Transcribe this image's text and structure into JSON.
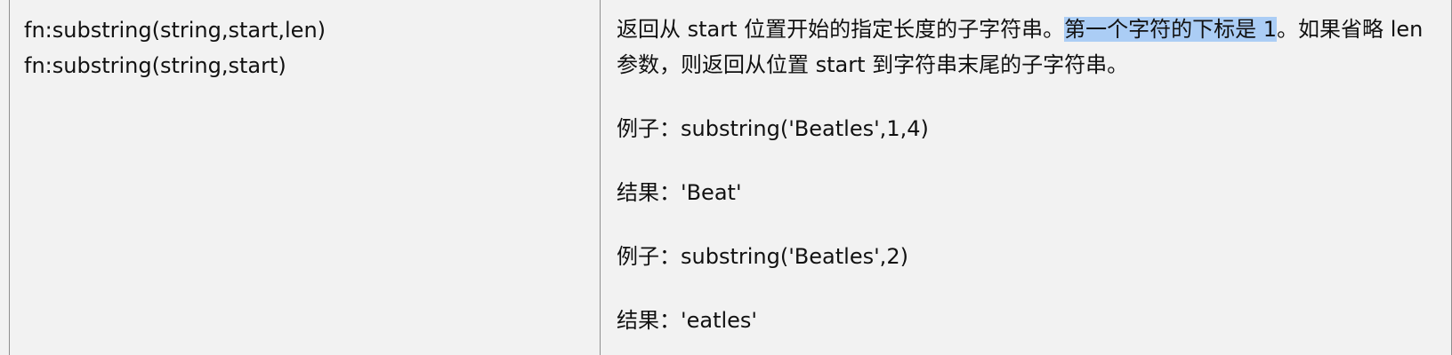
{
  "signature_cell": {
    "lines": [
      "fn:substring(string,start,len)",
      "fn:substring(string,start)"
    ]
  },
  "description_cell": {
    "text_before_highlight": "返回从 start 位置开始的指定长度的子字符串。",
    "highlighted_text": "第一个字符的下标是 1",
    "text_after_highlight": "。如果省略 len 参数，则返回从位置 start 到字符串末尾的子字符串。",
    "examples": [
      "例子：substring('Beatles',1,4)",
      "结果：'Beat'",
      "例子：substring('Beatles',2)",
      "结果：'eatles'"
    ]
  },
  "colors": {
    "background": "#f2f2f2",
    "border": "#8f8f8f",
    "selection_highlight": "#abcdf5",
    "text": "#111111"
  }
}
